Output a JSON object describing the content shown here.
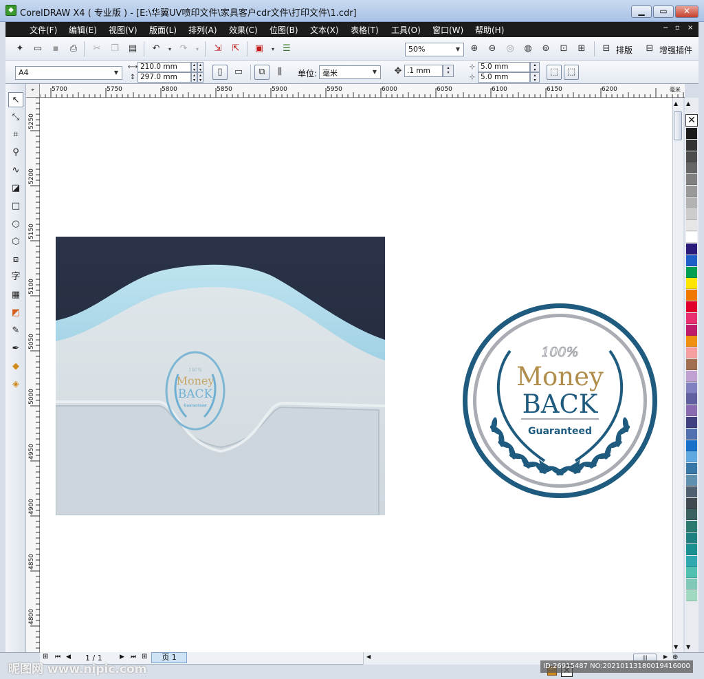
{
  "window": {
    "title": "CorelDRAW X4 ( 专业版 ) - [E:\\华翼UV喷印文件\\家具客户cdr文件\\打印文件\\1.cdr]",
    "minimize": "▁",
    "maximize": "▭",
    "close": "✕"
  },
  "menu": [
    "文件(F)",
    "编辑(E)",
    "视图(V)",
    "版面(L)",
    "排列(A)",
    "效果(C)",
    "位图(B)",
    "文本(X)",
    "表格(T)",
    "工具(O)",
    "窗口(W)",
    "帮助(H)"
  ],
  "menu_right": [
    "−",
    "▫",
    "×"
  ],
  "toolbar1": {
    "zoom": "50%",
    "layout_label": "排版",
    "plugin_label": "增强插件"
  },
  "toolbar2": {
    "paper_size": "A4",
    "width": "210.0 mm",
    "height": "297.0 mm",
    "units_label": "单位:",
    "units": "毫米",
    "nudge": ".1 mm",
    "dup_x": "5.0 mm",
    "dup_y": "5.0 mm"
  },
  "ruler": {
    "h_ticks": [
      "5700",
      "5750",
      "5800",
      "5850",
      "5900",
      "5950",
      "6000",
      "6050",
      "6100",
      "6150",
      "6200"
    ],
    "h_unit": "毫米",
    "v_ticks": [
      "5250",
      "5200",
      "5150",
      "5100",
      "5050",
      "5000",
      "4950",
      "4900",
      "4850",
      "4800"
    ]
  },
  "tools": [
    "pick",
    "shape",
    "crop",
    "zoom",
    "freehand",
    "smart-fill",
    "rectangle",
    "ellipse",
    "polygon",
    "basic-shapes",
    "text",
    "table",
    "interactive",
    "eyedropper",
    "outline",
    "fill",
    "interactive-fill"
  ],
  "tool_text_glyph": "字",
  "palette_colors": [
    "#1a1a1a",
    "#333333",
    "#4d4d4d",
    "#666666",
    "#808080",
    "#999999",
    "#b3b3b3",
    "#cccccc",
    "#e6e6e6",
    "#ffffff",
    "#2a1a7a",
    "#1f5fc8",
    "#00a050",
    "#ffe600",
    "#f07800",
    "#e0002a",
    "#e83070",
    "#c01a6a",
    "#f09010",
    "#f4a0a0",
    "#a07050",
    "#c0a0d0",
    "#8080c0",
    "#6060a0",
    "#8a6ab0",
    "#404080",
    "#5070b0",
    "#1870c8",
    "#60a8e0",
    "#3878a8",
    "#6090b0",
    "#506070",
    "#404a50",
    "#3a6060",
    "#2a7a70",
    "#208080",
    "#1a9090",
    "#30a8b0",
    "#50c0b0",
    "#80c8b8",
    "#a0d8c0"
  ],
  "statusbar": {
    "page_count": "1 / 1",
    "page_tab": "页 1"
  },
  "seal": {
    "top": "100%",
    "money": "Money",
    "back": "BACK",
    "guaranteed": "Guaranteed"
  },
  "photo_seal": {
    "top": "100%",
    "money": "Money",
    "back": "BACK",
    "guaranteed": "Guaranteed"
  },
  "watermarks": {
    "left": "昵图网 www.nipic.com",
    "right": "ID:26915487 NO:20210113180019416000"
  },
  "colors": {
    "seal_blue": "#1f5b7e",
    "seal_gold": "#b08d4a",
    "seal_gray": "#a9acb2"
  }
}
